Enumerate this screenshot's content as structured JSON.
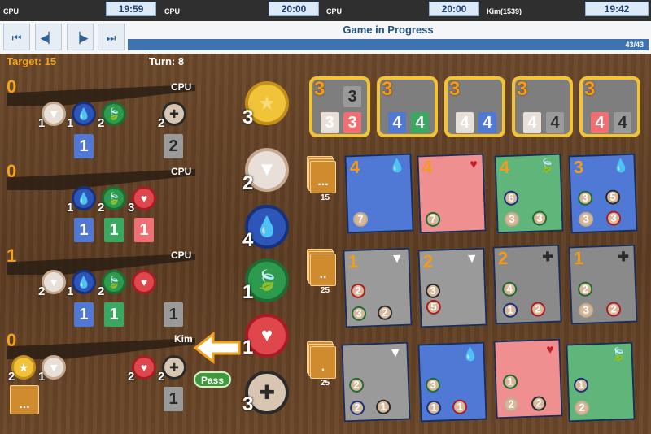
{
  "players_bar": [
    {
      "name": "CPU",
      "time": "19:59"
    },
    {
      "name": "CPU",
      "time": "20:00"
    },
    {
      "name": "CPU",
      "time": "20:00"
    },
    {
      "name": "Kim(1539)",
      "time": "19:42"
    }
  ],
  "nav": {
    "first_icon": "first-icon",
    "prev_icon": "previous-icon",
    "next_icon": "next-icon",
    "last_icon": "last-icon",
    "title": "Game in Progress",
    "progress_text": "43/43",
    "progress_fraction": 1.0
  },
  "status": {
    "target": "Target: 15",
    "turn": "Turn: 8"
  },
  "players": [
    {
      "score": "0",
      "name": "CPU",
      "tokens": [
        "1",
        "1",
        "2",
        "2"
      ],
      "cards": [
        "1",
        "2"
      ]
    },
    {
      "score": "0",
      "name": "CPU",
      "tokens": [
        "1",
        "2",
        "3"
      ],
      "cards": [
        "1",
        "1",
        "1"
      ]
    },
    {
      "score": "1",
      "name": "CPU",
      "tokens": [
        "2",
        "1",
        "2"
      ],
      "cards": [
        "1",
        "1",
        "1"
      ]
    },
    {
      "score": "0",
      "name": "Kim",
      "tokens": [
        "2",
        "1",
        "2",
        "2"
      ],
      "cards": [
        "1"
      ],
      "reserved": "..."
    }
  ],
  "bank": [
    "3",
    "2",
    "4",
    "1",
    "1",
    "3"
  ],
  "nobles": [
    {
      "points": "3",
      "reqs": [
        "3",
        "3",
        "3"
      ]
    },
    {
      "points": "3",
      "reqs": [
        "4",
        "4"
      ]
    },
    {
      "points": "3",
      "reqs": [
        "4",
        "4"
      ]
    },
    {
      "points": "3",
      "reqs": [
        "4",
        "4"
      ]
    },
    {
      "points": "3",
      "reqs": [
        "4",
        "4"
      ]
    }
  ],
  "decks": [
    {
      "count": "15",
      "dots": "..."
    },
    {
      "count": "25",
      "dots": ".."
    },
    {
      "count": "25",
      "dots": "."
    }
  ],
  "tier3": [
    {
      "points": "4",
      "costs": [
        "7"
      ]
    },
    {
      "points": "4",
      "costs": [
        "7"
      ]
    },
    {
      "points": "4",
      "costs": [
        "6",
        "3",
        "3"
      ]
    },
    {
      "points": "3",
      "costs": [
        "3",
        "5",
        "3",
        "3"
      ]
    }
  ],
  "tier2": [
    {
      "points": "1",
      "costs": [
        "2",
        "3",
        "2"
      ]
    },
    {
      "points": "2",
      "costs": [
        "3",
        "5"
      ]
    },
    {
      "points": "2",
      "costs": [
        "4",
        "1",
        "2"
      ]
    },
    {
      "points": "1",
      "costs": [
        "2",
        "3",
        "2"
      ]
    }
  ],
  "tier1": [
    {
      "points": "",
      "costs": [
        "2",
        "2",
        "1"
      ]
    },
    {
      "points": "",
      "costs": [
        "3",
        "1",
        "1"
      ]
    },
    {
      "points": "",
      "costs": [
        "1",
        "2",
        "2"
      ]
    },
    {
      "points": "",
      "costs": [
        "1",
        "2"
      ]
    }
  ],
  "pass_label": "Pass",
  "colors": {
    "white": "#e8e0d8",
    "blue": "#2e56b8",
    "green": "#2e9a4e",
    "red": "#e0474c",
    "black": "#2a2a2a",
    "gold": "#f0c338"
  }
}
